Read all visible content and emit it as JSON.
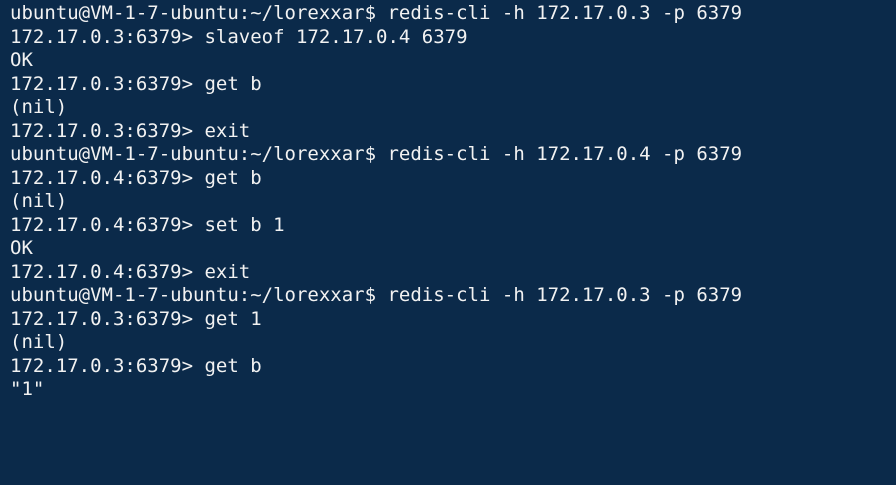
{
  "terminal": {
    "lines": [
      "ubuntu@VM-1-7-ubuntu:~/lorexxar$ redis-cli -h 172.17.0.3 -p 6379",
      "172.17.0.3:6379> slaveof 172.17.0.4 6379",
      "OK",
      "172.17.0.3:6379> get b",
      "(nil)",
      "172.17.0.3:6379> exit",
      "ubuntu@VM-1-7-ubuntu:~/lorexxar$ redis-cli -h 172.17.0.4 -p 6379",
      "172.17.0.4:6379> get b",
      "(nil)",
      "172.17.0.4:6379> set b 1",
      "OK",
      "172.17.0.4:6379> exit",
      "ubuntu@VM-1-7-ubuntu:~/lorexxar$ redis-cli -h 172.17.0.3 -p 6379",
      "172.17.0.3:6379> get 1",
      "(nil)",
      "172.17.0.3:6379> get b",
      "\"1\""
    ],
    "colors": {
      "background": "#0b2a4a",
      "text": "#f2f2f2"
    }
  }
}
